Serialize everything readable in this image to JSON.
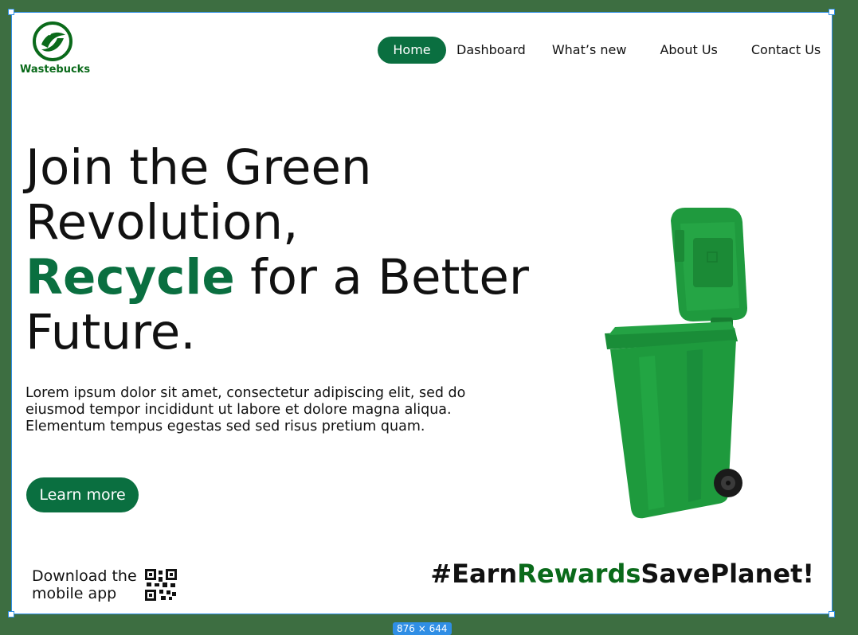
{
  "brand": {
    "name": "Wastebucks",
    "logo_icon": "leaf-globe-icon"
  },
  "nav": {
    "items": [
      {
        "label": "Home",
        "active": true
      },
      {
        "label": "Dashboard"
      },
      {
        "label": "What’s new"
      },
      {
        "label": "About Us"
      },
      {
        "label": "Contact Us"
      }
    ]
  },
  "hero": {
    "title_line1": "Join the Green",
    "title_line2": "Revolution,",
    "title_accent": "Recycle",
    "title_line3_rest": " for a Better",
    "title_line4": "Future.",
    "description": "Lorem ipsum dolor sit amet, consectetur adipiscing elit, sed do eiusmod tempor incididunt ut labore et dolore magna aliqua. Elementum tempus egestas sed sed risus pretium quam.",
    "cta_label": "Learn more",
    "image_icon": "green-wheelie-bin"
  },
  "download": {
    "text": "Download the mobile app",
    "qr_icon": "qr-code-icon"
  },
  "hashtag": {
    "part1": "#Earn",
    "part2": "Rewards",
    "part3": "SavePlanet!"
  },
  "canvas": {
    "size_label": "876 × 644"
  },
  "colors": {
    "primary": "#0a6f40",
    "brand_green": "#0a6a1a",
    "page_bg": "#3d6e41",
    "selection": "#2f8ee5"
  }
}
